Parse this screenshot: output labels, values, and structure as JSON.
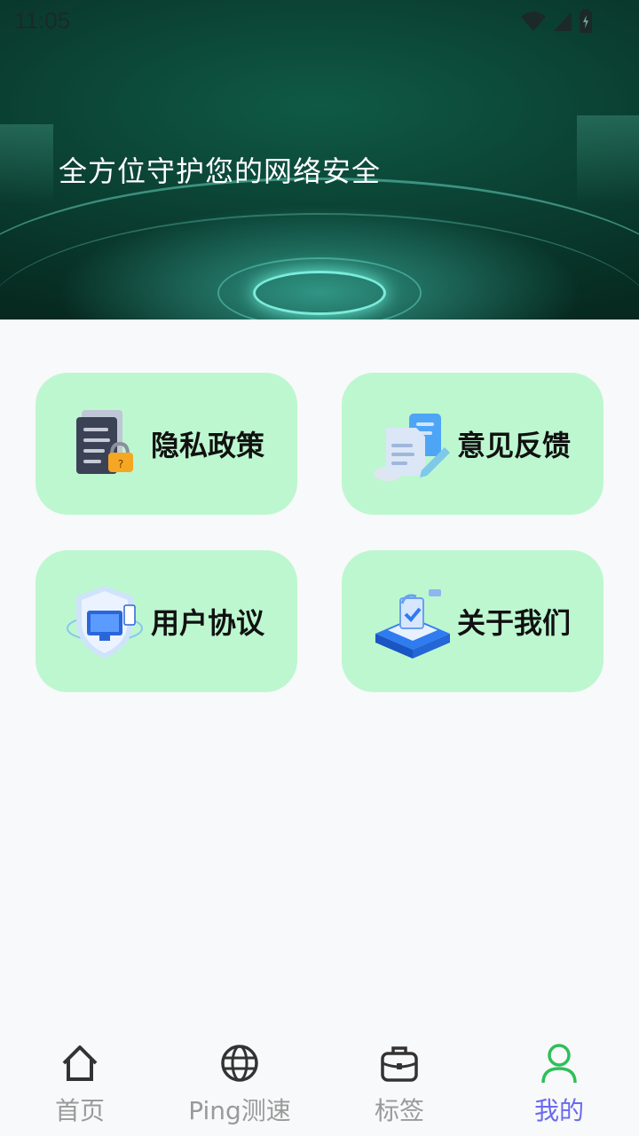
{
  "status_bar": {
    "time": "11:05"
  },
  "hero": {
    "title": "全方位守护您的网络安全"
  },
  "cards": [
    {
      "id": "privacy",
      "label": "隐私政策",
      "icon": "locked-document-icon"
    },
    {
      "id": "feedback",
      "label": "意见反馈",
      "icon": "edit-document-icon"
    },
    {
      "id": "agreement",
      "label": "用户协议",
      "icon": "shield-monitor-icon"
    },
    {
      "id": "about",
      "label": "关于我们",
      "icon": "server-platform-icon"
    }
  ],
  "tabbar": {
    "tabs": [
      {
        "label": "首页",
        "icon": "home-icon",
        "active": false
      },
      {
        "label": "Ping测速",
        "icon": "globe-icon",
        "active": false
      },
      {
        "label": "标签",
        "icon": "briefcase-icon",
        "active": false
      },
      {
        "label": "我的",
        "icon": "user-icon",
        "active": true
      }
    ]
  },
  "colors": {
    "card_bg": "#bdf7d0",
    "active_tab": "#6a6af0",
    "active_icon": "#2fbf5a",
    "inactive_tab": "#9a9a9a"
  }
}
